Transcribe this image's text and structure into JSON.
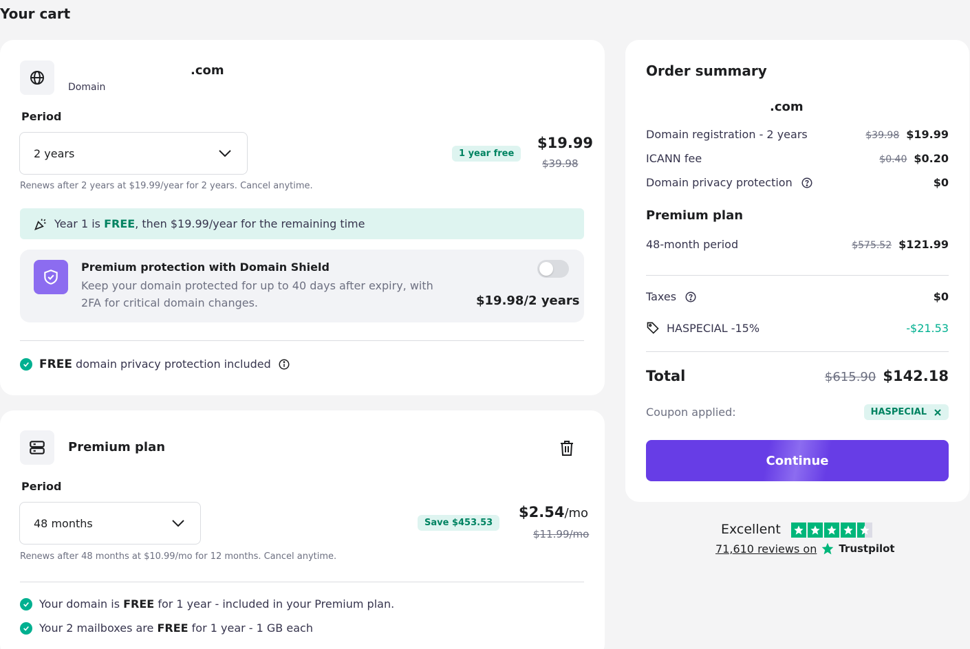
{
  "page": {
    "title": "Your cart"
  },
  "domain_item": {
    "name": ".com",
    "type": "Domain",
    "period_label": "Period",
    "period_value": "2 years",
    "badge": "1 year free",
    "price": "$19.99",
    "old_price": "$39.98",
    "renew_note": "Renews after 2 years at $19.99/year for 2 years. Cancel anytime.",
    "banner_prefix": "Year 1 is ",
    "banner_free": "FREE",
    "banner_suffix": ", then $19.99/year for the remaining time",
    "shield_title": "Premium protection with Domain Shield",
    "shield_desc_line1": "Keep your domain protected for up to 40 days after expiry, with",
    "shield_desc_line2": "2FA for critical domain changes.",
    "shield_price": "$19.98/2 years",
    "privacy_free": "FREE",
    "privacy_text": "domain privacy protection included"
  },
  "plan_item": {
    "name": "Premium plan",
    "period_label": "Period",
    "period_value": "48 months",
    "badge": "Save $453.53",
    "price": "$2.54",
    "price_unit": "/mo",
    "old_price": "$11.99/mo",
    "renew_note": "Renews after 48 months at $10.99/mo for 12 months. Cancel anytime.",
    "feature1_prefix": "Your domain is ",
    "feature1_bold": "FREE",
    "feature1_suffix": " for 1 year - included in your Premium plan.",
    "feature2_prefix": "Your 2 mailboxes are ",
    "feature2_bold": "FREE",
    "feature2_suffix": " for 1 year - 1 GB each"
  },
  "summary": {
    "title": "Order summary",
    "domain_name": ".com",
    "rows": [
      {
        "label": "Domain registration - 2 years",
        "old": "$39.98",
        "new": "$19.99"
      },
      {
        "label": "ICANN fee",
        "old": "$0.40",
        "new": "$0.20"
      },
      {
        "label": "Domain privacy protection",
        "old": "",
        "new": "$0"
      }
    ],
    "plan_heading": "Premium plan",
    "plan_row": {
      "label": "48-month period",
      "old": "$575.52",
      "new": "$121.99"
    },
    "taxes_label": "Taxes",
    "taxes_value": "$0",
    "discount_label": "HASPECIAL -15%",
    "discount_value": "-$21.53",
    "total_label": "Total",
    "total_old": "$615.90",
    "total_new": "$142.18",
    "coupon_label": "Coupon applied:",
    "coupon_code": "HASPECIAL",
    "continue_label": "Continue"
  },
  "trustpilot": {
    "rating_text": "Excellent",
    "reviews_text": "71,610 reviews on",
    "brand": "Trustpilot",
    "stars": 4.5
  },
  "colors": {
    "accent": "#673de6",
    "success": "#00b090",
    "success_text": "#008361",
    "trust_green": "#00b67a"
  }
}
